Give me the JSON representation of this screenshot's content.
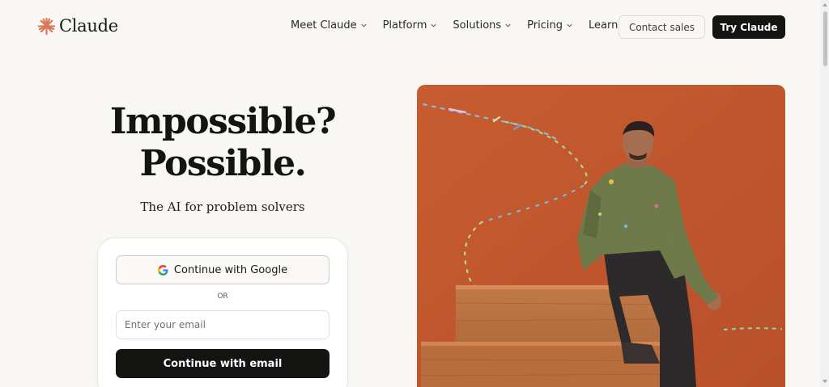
{
  "brand": {
    "name": "Claude",
    "accent": "#d97757"
  },
  "nav": {
    "items": [
      {
        "label": "Meet Claude"
      },
      {
        "label": "Platform"
      },
      {
        "label": "Solutions"
      },
      {
        "label": "Pricing"
      },
      {
        "label": "Learn"
      }
    ],
    "contact_label": "Contact sales",
    "try_label": "Try Claude"
  },
  "hero": {
    "title_line1": "Impossible?",
    "title_line2": "Possible.",
    "subtitle": "The AI for problem solvers"
  },
  "signup": {
    "google_label": "Continue with Google",
    "or_label": "OR",
    "email_placeholder": "Enter your email",
    "email_button_label": "Continue with email"
  },
  "colors": {
    "background": "#f8f7f3",
    "dark_button": "#141413",
    "image_backdrop": "#c4592f"
  }
}
